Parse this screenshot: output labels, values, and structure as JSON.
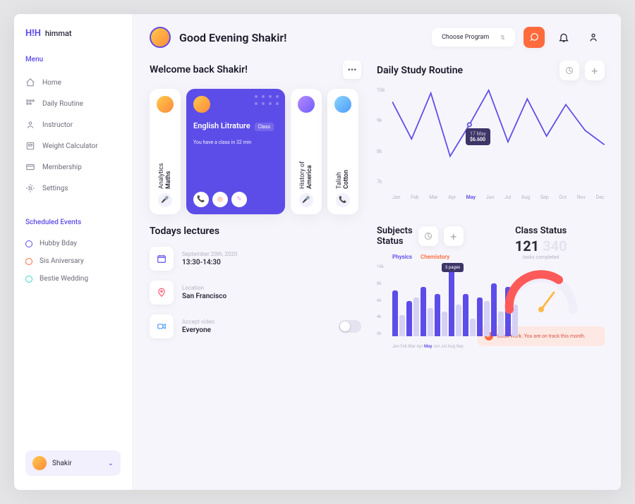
{
  "brand": {
    "icon": "H!H",
    "name": "himmat"
  },
  "menu": {
    "label": "Menu",
    "items": [
      "Home",
      "Daily Routine",
      "Instructor",
      "Weight Calculator",
      "Membership",
      "Settings"
    ]
  },
  "events": {
    "label": "Scheduled Events",
    "items": [
      {
        "color": "#5d4de8",
        "label": "Hubby Bday"
      },
      {
        "color": "#ff6b3d",
        "label": "Sis Aniversary"
      },
      {
        "color": "#3dd6c4",
        "label": "Bestie Wedding"
      }
    ]
  },
  "user": {
    "name": "Shakir"
  },
  "greeting": "Good Evening Shakir!",
  "program_select": "Choose Program",
  "welcome": {
    "title": "Welcome back Shakir!",
    "courses": [
      {
        "title": "Analytics Maths",
        "bold": "Maths"
      },
      {
        "title": "English Litrature",
        "tag": "Class",
        "sub": "You have a class in 32 min",
        "active": true
      },
      {
        "title": "History of America",
        "bold": "America"
      },
      {
        "title": "Taliah Cotton",
        "bold": "Cotton"
      }
    ]
  },
  "routine": {
    "title": "Daily Study Routine",
    "tooltip": {
      "label": "17 May",
      "value": "$6.600"
    }
  },
  "lectures": {
    "title": "Todays lectures",
    "items": [
      {
        "icon": "calendar",
        "label": "September 20th, 2020",
        "value": "13:30-14:30"
      },
      {
        "icon": "pin",
        "label": "Location",
        "value": "San Francisco"
      },
      {
        "icon": "video",
        "label": "Accept video",
        "value": "Everyone",
        "toggle": true
      }
    ]
  },
  "subjects": {
    "title": "Subjects Status",
    "tabs": [
      "Physics",
      "Chemistory"
    ],
    "tooltip": "5 pages"
  },
  "status": {
    "title": "Class Status",
    "value": "121",
    "sub": "tasks completed",
    "message": "Good Work. You are on track this month."
  },
  "chart_data": {
    "line": {
      "type": "line",
      "title": "Daily Study Routine",
      "ylabel": "",
      "ylim": [
        7000,
        10000
      ],
      "yticks": [
        "10k",
        "9k",
        "8k",
        "7k"
      ],
      "categories": [
        "Jan",
        "Feb",
        "Mar",
        "Apr",
        "May",
        "Jun",
        "Jul",
        "Aug",
        "Sep",
        "Oct",
        "Nov",
        "Dec"
      ],
      "values": [
        9500,
        8200,
        9800,
        7600,
        8700,
        9900,
        8100,
        9600,
        8300,
        9400,
        8500,
        8000
      ],
      "highlight": {
        "category": "May",
        "note_label": "17 May",
        "note_value": "$6.600"
      }
    },
    "bars": {
      "type": "bar",
      "title": "Subjects Status",
      "ylabel": "",
      "ylim": [
        0,
        10000
      ],
      "yticks": [
        "10k",
        "8k",
        "6k",
        "4k",
        "0k"
      ],
      "categories": [
        "Jan",
        "Feb",
        "Mar",
        "Apr",
        "May",
        "Jun",
        "Jul",
        "Aug",
        "Sep"
      ],
      "series": [
        {
          "name": "Physics",
          "values": [
            6500,
            5000,
            7000,
            6000,
            9500,
            6000,
            5500,
            7500,
            7000
          ]
        },
        {
          "name": "Chemistory",
          "values": [
            3000,
            5500,
            4000,
            3500,
            4500,
            2500,
            5000,
            3500,
            4500
          ]
        }
      ],
      "highlight": {
        "category": "May",
        "label": "5 pages"
      }
    },
    "gauge": {
      "type": "gauge",
      "value": 121,
      "range": [
        0,
        180
      ],
      "fill_percent": 60
    }
  }
}
